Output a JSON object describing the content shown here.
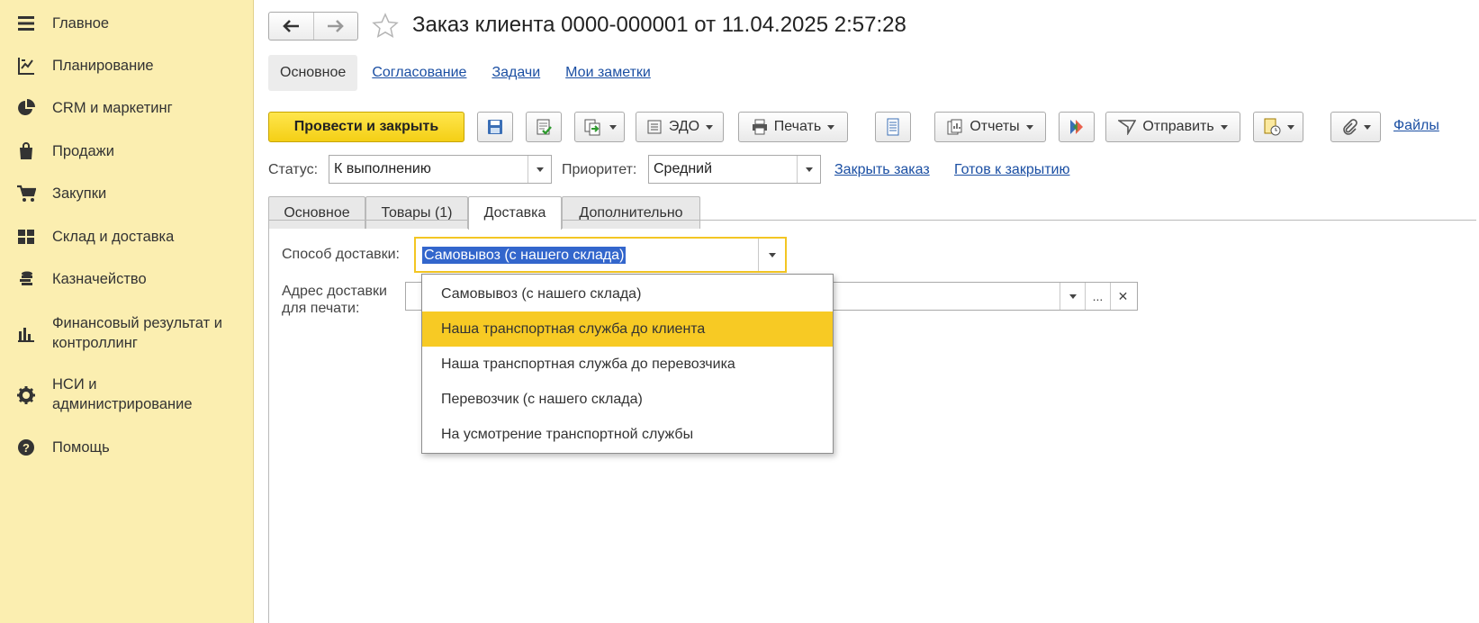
{
  "sidebar": {
    "items": [
      {
        "label": "Главное",
        "icon": "menu-icon"
      },
      {
        "label": "Планирование",
        "icon": "planning-icon"
      },
      {
        "label": "CRM и маркетинг",
        "icon": "pie-chart-icon"
      },
      {
        "label": "Продажи",
        "icon": "shopping-bag-icon"
      },
      {
        "label": "Закупки",
        "icon": "cart-icon"
      },
      {
        "label": "Склад и доставка",
        "icon": "warehouse-icon"
      },
      {
        "label": "Казначейство",
        "icon": "coins-icon"
      },
      {
        "label": "Финансовый результат и\nконтроллинг",
        "icon": "bar-chart-icon"
      },
      {
        "label": "НСИ и\nадминистрирование",
        "icon": "gear-icon"
      },
      {
        "label": "Помощь",
        "icon": "help-icon"
      }
    ]
  },
  "header": {
    "title": "Заказ клиента 0000-000001 от 11.04.2025 2:57:28"
  },
  "page_tabs": [
    "Основное",
    "Согласование",
    "Задачи",
    "Мои заметки"
  ],
  "toolbar": {
    "post_close": "Провести и закрыть",
    "edo": "ЭДО",
    "print": "Печать",
    "reports": "Отчеты",
    "send": "Отправить",
    "files": "Файлы"
  },
  "status_row": {
    "status_label": "Статус:",
    "status_value": "К выполнению",
    "priority_label": "Приоритет:",
    "priority_value": "Средний",
    "close_order": "Закрыть заказ",
    "ready_to_close": "Готов к закрытию"
  },
  "form_tabs": [
    "Основное",
    "Товары (1)",
    "Доставка",
    "Дополнительно"
  ],
  "delivery": {
    "method_label": "Способ доставки:",
    "method_value": "Самовывоз (с нашего склада)",
    "address_label": "Адрес доставки\nдля печати:",
    "options": [
      "Самовывоз (с нашего склада)",
      "Наша транспортная служба до клиента",
      "Наша транспортная служба до перевозчика",
      "Перевозчик (с нашего склада)",
      "На усмотрение транспортной службы"
    ],
    "highlighted_index": 1
  },
  "colors": {
    "sidebar_bg": "#fbeeb0",
    "accent_yellow": "#f7ca24",
    "link": "#1b4fa3",
    "selection": "#3366cc"
  }
}
